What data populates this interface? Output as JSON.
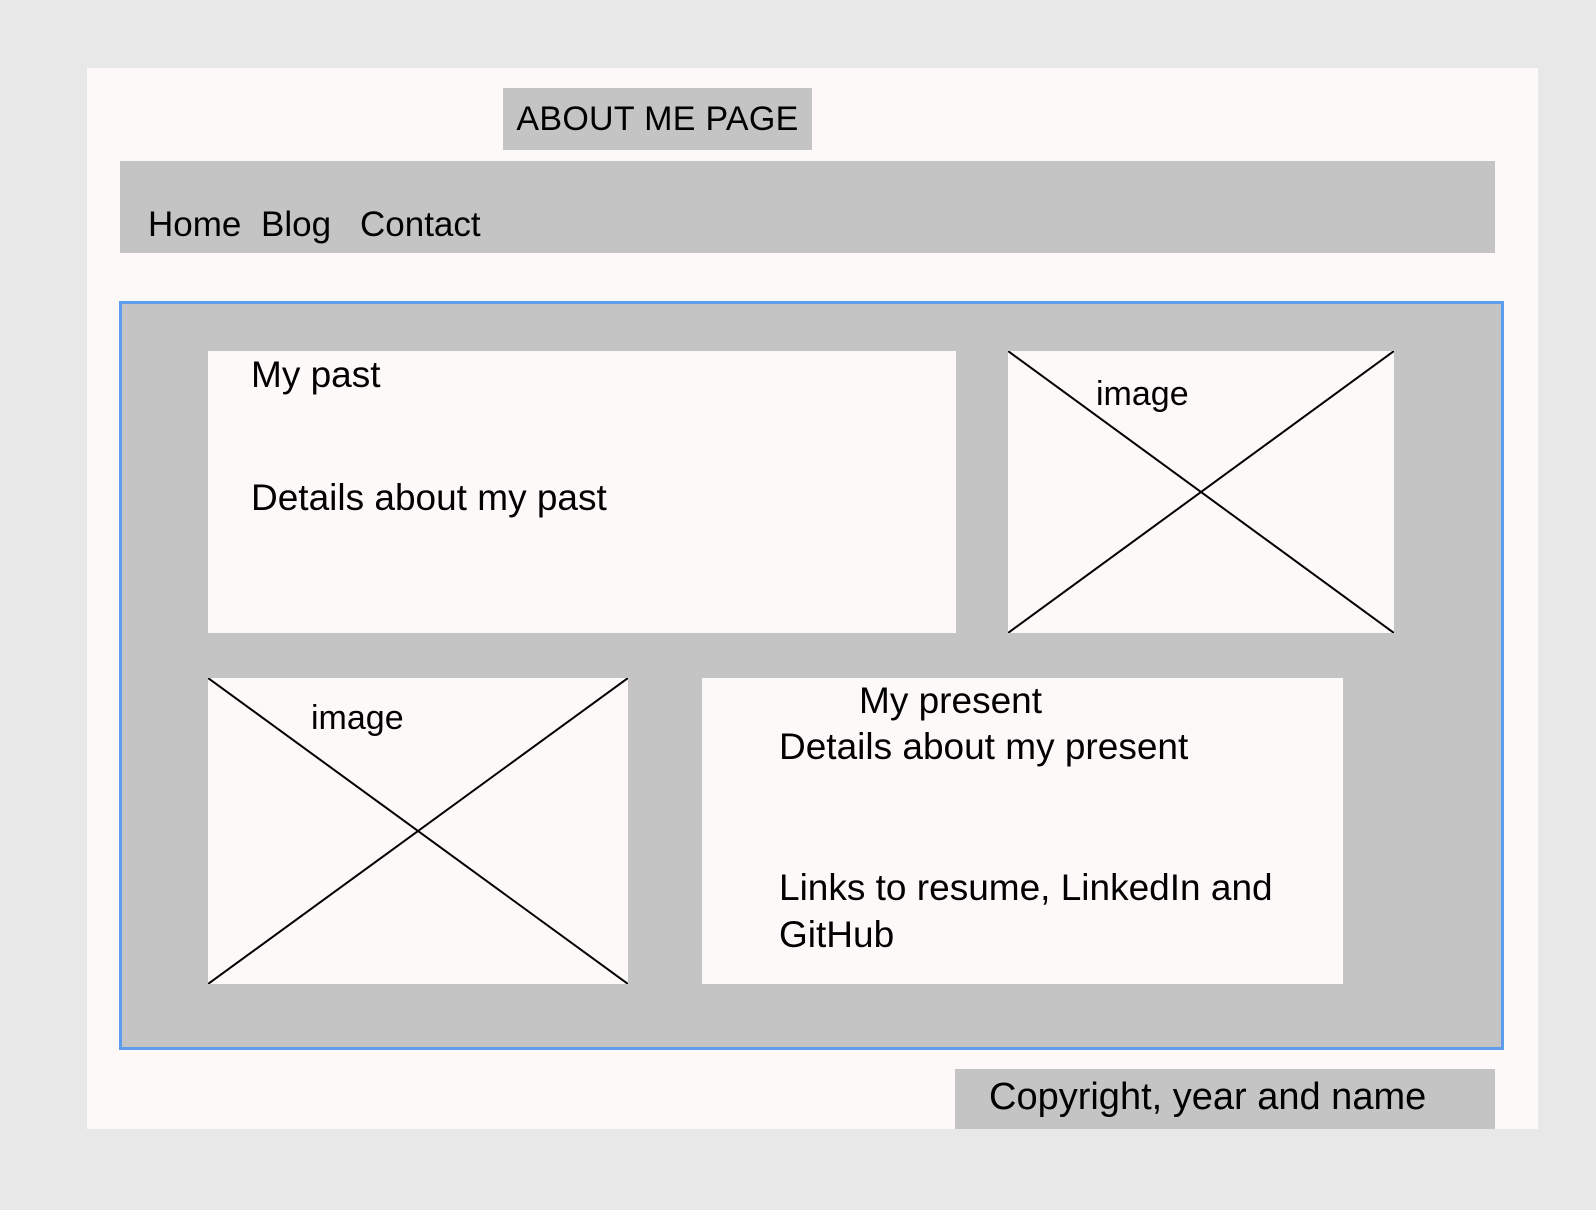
{
  "header": {
    "title": "ABOUT ME PAGE"
  },
  "nav": {
    "items": [
      {
        "label": "Home"
      },
      {
        "label": "Blog"
      },
      {
        "label": "Contact"
      }
    ]
  },
  "past": {
    "heading": "My past",
    "details": "Details about my past"
  },
  "past_image": {
    "label": "image"
  },
  "present_image": {
    "label": "image"
  },
  "present": {
    "heading": "My present",
    "details": "Details about my present",
    "links_line1": "Links to resume, LinkedIn and",
    "links_line2": "GitHub"
  },
  "footer": {
    "text": "Copyright, year and name"
  }
}
